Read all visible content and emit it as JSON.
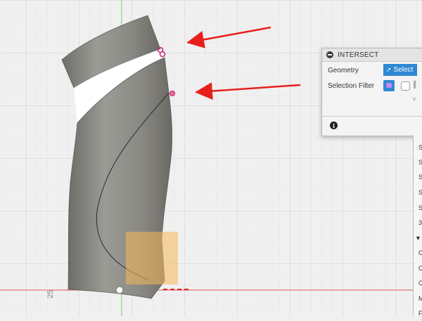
{
  "viewport": {
    "axis_label": "25",
    "colors": {
      "body": "#8c8b85",
      "highlight": "#f5b95a",
      "arrow": "#e8201c",
      "point": "#c8307a"
    }
  },
  "dialog": {
    "title": "INTERSECT",
    "geometry_label": "Geometry",
    "select_label": "Select",
    "selection_filter_label": "Selection Filter"
  },
  "side_panel": {
    "items": [
      "S",
      "S",
      "S",
      "S",
      "S",
      "3",
      "▼",
      "C",
      "C",
      "C",
      "M",
      "F"
    ]
  }
}
